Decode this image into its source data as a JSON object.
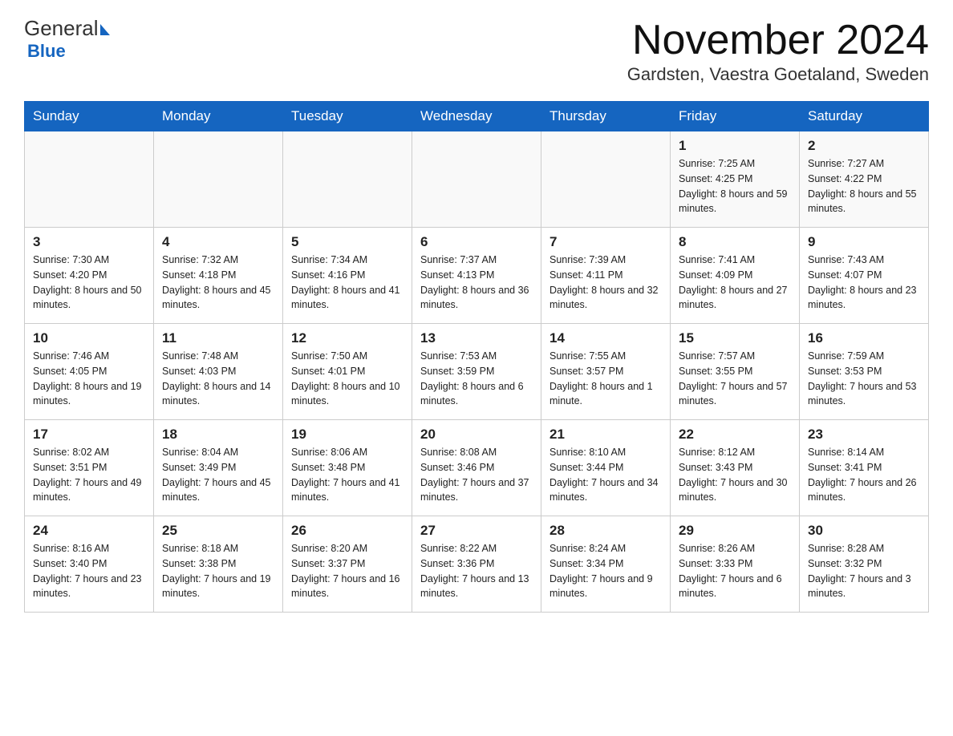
{
  "header": {
    "logo_general": "General",
    "logo_blue": "Blue",
    "month_title": "November 2024",
    "location": "Gardsten, Vaestra Goetaland, Sweden"
  },
  "weekdays": [
    "Sunday",
    "Monday",
    "Tuesday",
    "Wednesday",
    "Thursday",
    "Friday",
    "Saturday"
  ],
  "rows": [
    [
      {
        "day": "",
        "info": ""
      },
      {
        "day": "",
        "info": ""
      },
      {
        "day": "",
        "info": ""
      },
      {
        "day": "",
        "info": ""
      },
      {
        "day": "",
        "info": ""
      },
      {
        "day": "1",
        "info": "Sunrise: 7:25 AM\nSunset: 4:25 PM\nDaylight: 8 hours and 59 minutes."
      },
      {
        "day": "2",
        "info": "Sunrise: 7:27 AM\nSunset: 4:22 PM\nDaylight: 8 hours and 55 minutes."
      }
    ],
    [
      {
        "day": "3",
        "info": "Sunrise: 7:30 AM\nSunset: 4:20 PM\nDaylight: 8 hours and 50 minutes."
      },
      {
        "day": "4",
        "info": "Sunrise: 7:32 AM\nSunset: 4:18 PM\nDaylight: 8 hours and 45 minutes."
      },
      {
        "day": "5",
        "info": "Sunrise: 7:34 AM\nSunset: 4:16 PM\nDaylight: 8 hours and 41 minutes."
      },
      {
        "day": "6",
        "info": "Sunrise: 7:37 AM\nSunset: 4:13 PM\nDaylight: 8 hours and 36 minutes."
      },
      {
        "day": "7",
        "info": "Sunrise: 7:39 AM\nSunset: 4:11 PM\nDaylight: 8 hours and 32 minutes."
      },
      {
        "day": "8",
        "info": "Sunrise: 7:41 AM\nSunset: 4:09 PM\nDaylight: 8 hours and 27 minutes."
      },
      {
        "day": "9",
        "info": "Sunrise: 7:43 AM\nSunset: 4:07 PM\nDaylight: 8 hours and 23 minutes."
      }
    ],
    [
      {
        "day": "10",
        "info": "Sunrise: 7:46 AM\nSunset: 4:05 PM\nDaylight: 8 hours and 19 minutes."
      },
      {
        "day": "11",
        "info": "Sunrise: 7:48 AM\nSunset: 4:03 PM\nDaylight: 8 hours and 14 minutes."
      },
      {
        "day": "12",
        "info": "Sunrise: 7:50 AM\nSunset: 4:01 PM\nDaylight: 8 hours and 10 minutes."
      },
      {
        "day": "13",
        "info": "Sunrise: 7:53 AM\nSunset: 3:59 PM\nDaylight: 8 hours and 6 minutes."
      },
      {
        "day": "14",
        "info": "Sunrise: 7:55 AM\nSunset: 3:57 PM\nDaylight: 8 hours and 1 minute."
      },
      {
        "day": "15",
        "info": "Sunrise: 7:57 AM\nSunset: 3:55 PM\nDaylight: 7 hours and 57 minutes."
      },
      {
        "day": "16",
        "info": "Sunrise: 7:59 AM\nSunset: 3:53 PM\nDaylight: 7 hours and 53 minutes."
      }
    ],
    [
      {
        "day": "17",
        "info": "Sunrise: 8:02 AM\nSunset: 3:51 PM\nDaylight: 7 hours and 49 minutes."
      },
      {
        "day": "18",
        "info": "Sunrise: 8:04 AM\nSunset: 3:49 PM\nDaylight: 7 hours and 45 minutes."
      },
      {
        "day": "19",
        "info": "Sunrise: 8:06 AM\nSunset: 3:48 PM\nDaylight: 7 hours and 41 minutes."
      },
      {
        "day": "20",
        "info": "Sunrise: 8:08 AM\nSunset: 3:46 PM\nDaylight: 7 hours and 37 minutes."
      },
      {
        "day": "21",
        "info": "Sunrise: 8:10 AM\nSunset: 3:44 PM\nDaylight: 7 hours and 34 minutes."
      },
      {
        "day": "22",
        "info": "Sunrise: 8:12 AM\nSunset: 3:43 PM\nDaylight: 7 hours and 30 minutes."
      },
      {
        "day": "23",
        "info": "Sunrise: 8:14 AM\nSunset: 3:41 PM\nDaylight: 7 hours and 26 minutes."
      }
    ],
    [
      {
        "day": "24",
        "info": "Sunrise: 8:16 AM\nSunset: 3:40 PM\nDaylight: 7 hours and 23 minutes."
      },
      {
        "day": "25",
        "info": "Sunrise: 8:18 AM\nSunset: 3:38 PM\nDaylight: 7 hours and 19 minutes."
      },
      {
        "day": "26",
        "info": "Sunrise: 8:20 AM\nSunset: 3:37 PM\nDaylight: 7 hours and 16 minutes."
      },
      {
        "day": "27",
        "info": "Sunrise: 8:22 AM\nSunset: 3:36 PM\nDaylight: 7 hours and 13 minutes."
      },
      {
        "day": "28",
        "info": "Sunrise: 8:24 AM\nSunset: 3:34 PM\nDaylight: 7 hours and 9 minutes."
      },
      {
        "day": "29",
        "info": "Sunrise: 8:26 AM\nSunset: 3:33 PM\nDaylight: 7 hours and 6 minutes."
      },
      {
        "day": "30",
        "info": "Sunrise: 8:28 AM\nSunset: 3:32 PM\nDaylight: 7 hours and 3 minutes."
      }
    ]
  ]
}
